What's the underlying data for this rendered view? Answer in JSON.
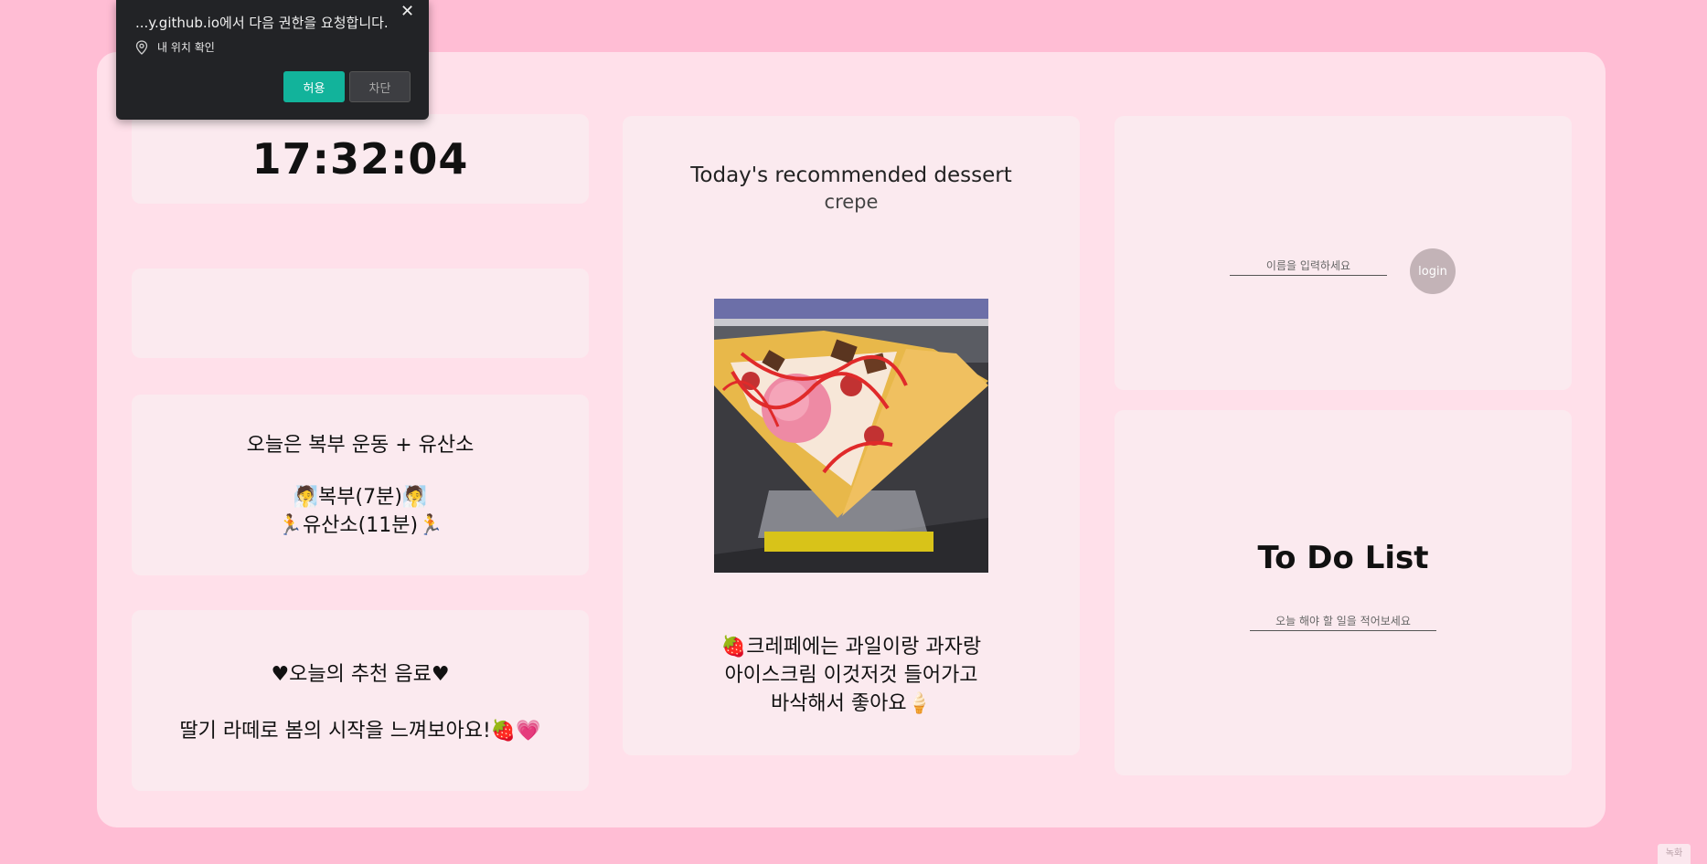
{
  "permission_popup": {
    "message": "...y.github.io에서 다음 권한을 요청합니다.",
    "permission_label": "내 위치 확인",
    "allow_label": "허용",
    "block_label": "차단",
    "close_symbol": "✕",
    "location_icon": "location-pin-icon"
  },
  "clock": {
    "time": "17:32:04"
  },
  "workout": {
    "title": "오늘은 복부 운동 + 유산소",
    "line1": "🧖복부(7분)🧖",
    "line2": "🏃유산소(11분)🏃"
  },
  "drink": {
    "title": "♥오늘의 추천 음료♥",
    "text": "딸기 라떼로 봄의 시작을 느껴보아요!🍓💗"
  },
  "dessert": {
    "heading": "Today's recommended dessert",
    "name": "crepe",
    "description_line1": "🍓크레페에는 과일이랑 과자랑",
    "description_line2": "아이스크림 이것저것 들어가고",
    "description_line3": "바삭해서 좋아요🍦"
  },
  "login": {
    "name_placeholder": "이름을 입력하세요",
    "button_label": "login"
  },
  "todo": {
    "title": "To Do List",
    "input_placeholder": "오늘 해야 할 일을 적어보세요"
  },
  "recording_badge": "녹화",
  "colors": {
    "page_background": "#ffbdd4",
    "board_background": "#ffe0ea",
    "card_background": "#fbeaef",
    "allow_button": "#12b39b",
    "login_button": "#c3b3b7"
  }
}
